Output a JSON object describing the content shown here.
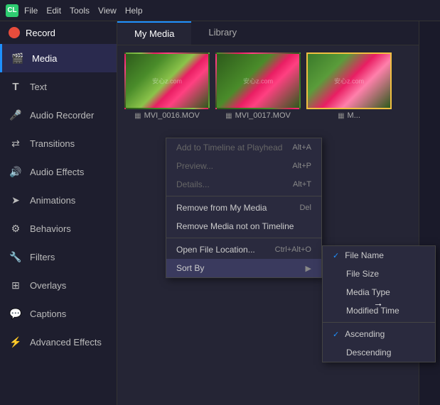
{
  "titlebar": {
    "logo": "CL",
    "menus": [
      "File",
      "Edit",
      "Tools",
      "View",
      "Help"
    ]
  },
  "sidebar": {
    "record_label": "Record",
    "items": [
      {
        "id": "media",
        "label": "Media",
        "icon": "🎬",
        "active": true
      },
      {
        "id": "text",
        "label": "Text",
        "icon": "T"
      },
      {
        "id": "audio-recorder",
        "label": "Audio Recorder",
        "icon": "🎤"
      },
      {
        "id": "transitions",
        "label": "Transitions",
        "icon": "⇄"
      },
      {
        "id": "audio-effects",
        "label": "Audio Effects",
        "icon": "🔊"
      },
      {
        "id": "animations",
        "label": "Animations",
        "icon": "➤"
      },
      {
        "id": "behaviors",
        "label": "Behaviors",
        "icon": "⚙"
      },
      {
        "id": "filters",
        "label": "Filters",
        "icon": "🔧"
      },
      {
        "id": "overlays",
        "label": "Overlays",
        "icon": "⊞"
      },
      {
        "id": "captions",
        "label": "Captions",
        "icon": "💬"
      },
      {
        "id": "advanced-effects",
        "label": "Advanced Effects",
        "icon": "⚡"
      }
    ]
  },
  "content": {
    "tabs": [
      "My Media",
      "Library"
    ],
    "active_tab": "My Media",
    "media_items": [
      {
        "id": 1,
        "label": "MVI_0016.MOV",
        "selected": false
      },
      {
        "id": 2,
        "label": "MVI_0017.MOV",
        "selected": false
      },
      {
        "id": 3,
        "label": "M...",
        "selected": true
      }
    ]
  },
  "context_menu": {
    "items": [
      {
        "id": "add-timeline",
        "label": "Add to Timeline at Playhead",
        "shortcut": "Alt+A",
        "disabled": false
      },
      {
        "id": "preview",
        "label": "Preview...",
        "shortcut": "Alt+P",
        "disabled": false
      },
      {
        "id": "details",
        "label": "Details...",
        "shortcut": "Alt+T",
        "disabled": false
      },
      {
        "id": "sep1",
        "type": "separator"
      },
      {
        "id": "remove-my-media",
        "label": "Remove from My Media",
        "shortcut": "Del",
        "disabled": false
      },
      {
        "id": "remove-not-timeline",
        "label": "Remove Media not on Timeline",
        "shortcut": "",
        "disabled": false
      },
      {
        "id": "sep2",
        "type": "separator"
      },
      {
        "id": "open-file-location",
        "label": "Open File Location...",
        "shortcut": "Ctrl+Alt+O",
        "disabled": false
      },
      {
        "id": "sort-by",
        "label": "Sort By",
        "shortcut": "",
        "has_arrow": true,
        "disabled": false
      }
    ]
  },
  "sort_submenu": {
    "items": [
      {
        "id": "file-name",
        "label": "File Name",
        "checked": true
      },
      {
        "id": "file-size",
        "label": "File Size",
        "checked": false
      },
      {
        "id": "media-type",
        "label": "Media Type",
        "checked": false
      },
      {
        "id": "modified-time",
        "label": "Modified Time",
        "checked": false
      },
      {
        "id": "sep",
        "type": "separator"
      },
      {
        "id": "ascending",
        "label": "Ascending",
        "checked": true
      },
      {
        "id": "descending",
        "label": "Descending",
        "checked": false
      }
    ]
  },
  "cursor": {
    "arrow": "→"
  }
}
